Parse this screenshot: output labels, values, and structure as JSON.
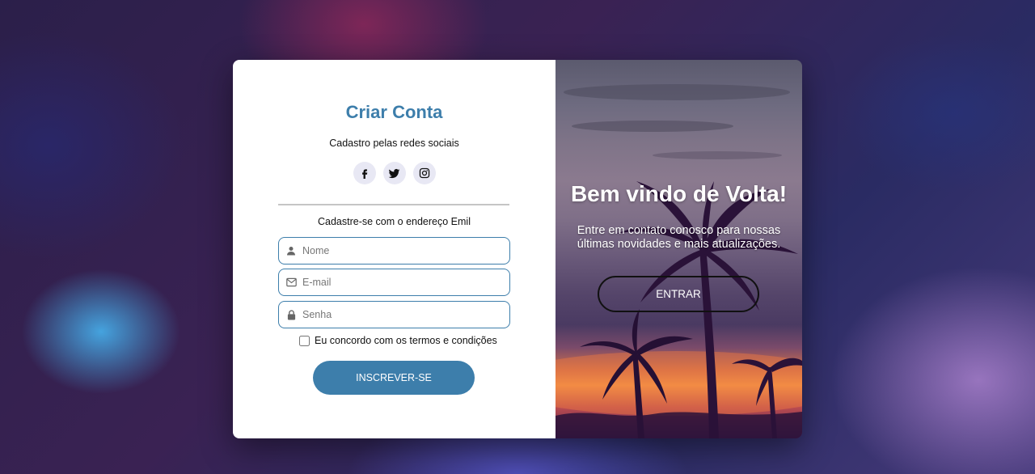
{
  "signup": {
    "title": "Criar Conta",
    "social_label": "Cadastro pelas redes sociais",
    "socials": [
      {
        "icon": "facebook-icon"
      },
      {
        "icon": "twitter-icon"
      },
      {
        "icon": "instagram-icon"
      }
    ],
    "email_label": "Cadastre-se com o endereço Emil",
    "fields": {
      "name_placeholder": "Nome",
      "email_placeholder": "E-mail",
      "password_placeholder": "Senha"
    },
    "terms_label": "Eu concordo com os termos e condições",
    "submit_label": "INSCREVER-SE"
  },
  "welcome": {
    "title": "Bem vindo de Volta!",
    "text": "Entre em contato conosco para nossas últimas novidades e mais atualizações.",
    "login_label": "ENTRAR"
  },
  "colors": {
    "accent": "#3d7eab",
    "social_bg": "#e8e8f4"
  }
}
